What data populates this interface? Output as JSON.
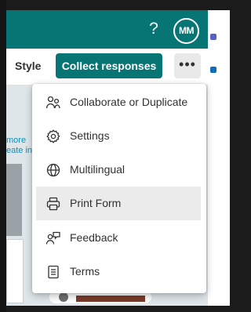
{
  "header": {
    "help_glyph": "?",
    "avatar_initials": "MM",
    "brand_color": "#087575"
  },
  "toolbar": {
    "style_label": "Style",
    "collect_label": "Collect responses",
    "more_glyph": "•••"
  },
  "canvas": {
    "link_line_1": "more",
    "link_line_2": "eate in"
  },
  "menu": {
    "items": [
      {
        "label": "Collaborate or Duplicate",
        "icon": "people-icon"
      },
      {
        "label": "Settings",
        "icon": "gear-icon"
      },
      {
        "label": "Multilingual",
        "icon": "globe-icon"
      },
      {
        "label": "Print Form",
        "icon": "printer-icon",
        "highlighted": true
      },
      {
        "label": "Feedback",
        "icon": "feedback-icon"
      },
      {
        "label": "Terms",
        "icon": "document-icon"
      }
    ]
  }
}
